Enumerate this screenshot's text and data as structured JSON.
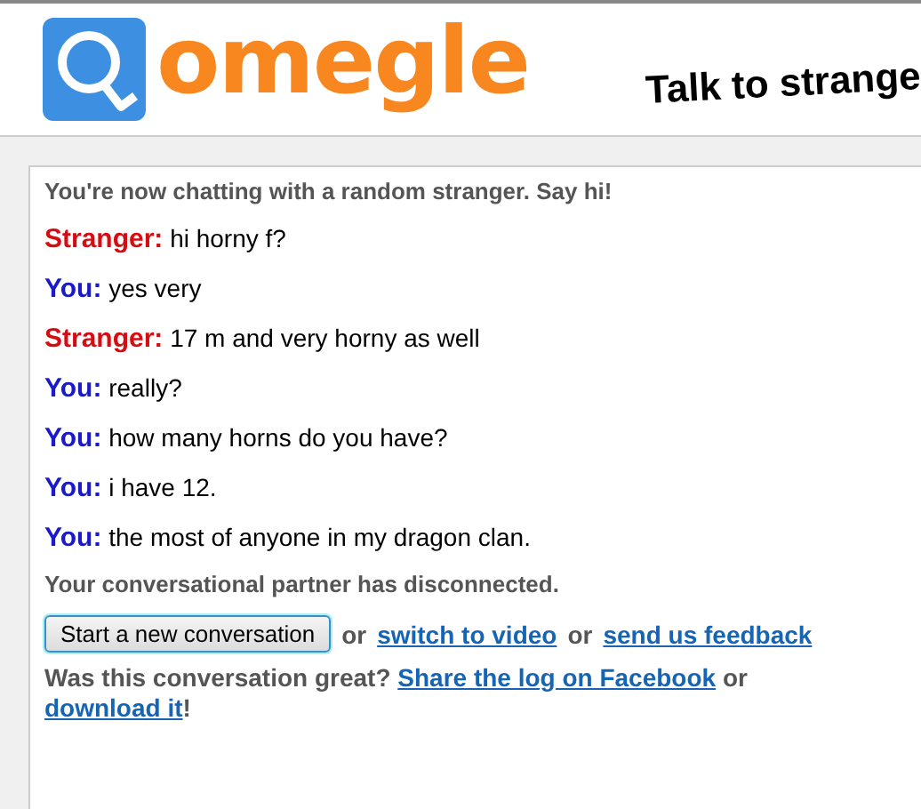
{
  "header": {
    "logo": "omegle",
    "tagline": "Talk to strange"
  },
  "chat": {
    "intro": "You're now chatting with a random stranger. Say hi!",
    "messages": [
      {
        "kind": "stranger",
        "speaker": "Stranger:",
        "text": "hi horny f?"
      },
      {
        "kind": "you",
        "speaker": "You:",
        "text": "yes very"
      },
      {
        "kind": "stranger",
        "speaker": "Stranger:",
        "text": "17 m and very horny as well"
      },
      {
        "kind": "you",
        "speaker": "You:",
        "text": "really?"
      },
      {
        "kind": "you",
        "speaker": "You:",
        "text": "how many horns do you have?"
      },
      {
        "kind": "you",
        "speaker": "You:",
        "text": "i have 12."
      },
      {
        "kind": "you",
        "speaker": "You:",
        "text": "the most of anyone in my dragon clan."
      }
    ],
    "status": "Your conversational partner has disconnected.",
    "button": "Start a new conversation",
    "actions": [
      {
        "kind": "text",
        "text": "or"
      },
      {
        "kind": "link",
        "text": "switch to video"
      },
      {
        "kind": "text",
        "text": "or"
      },
      {
        "kind": "link",
        "text": "send us feedback"
      }
    ],
    "feedback": [
      {
        "kind": "text",
        "text": "Was this conversation great? "
      },
      {
        "kind": "link",
        "text": "Share the log on Facebook"
      },
      {
        "kind": "text",
        "text": " or "
      },
      {
        "kind": "link",
        "text": "download it"
      },
      {
        "kind": "text",
        "text": "!"
      }
    ]
  }
}
